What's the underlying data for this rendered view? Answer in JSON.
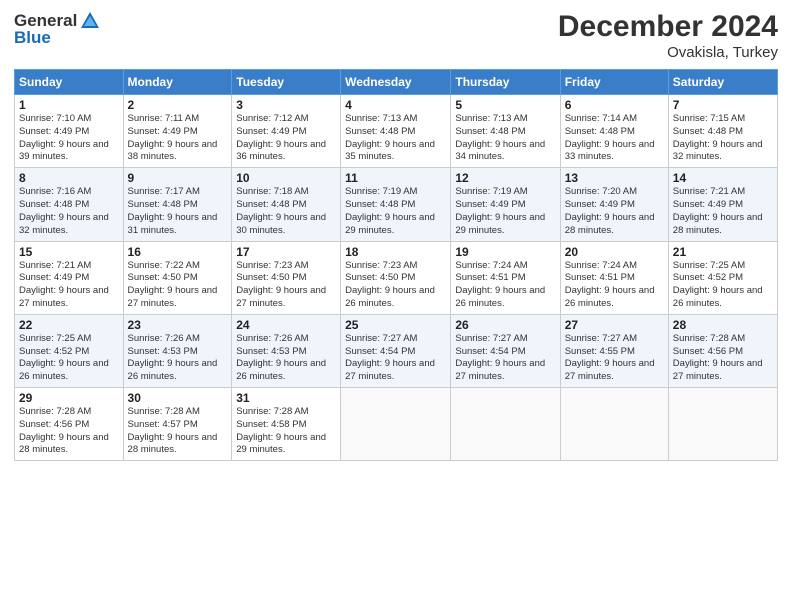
{
  "header": {
    "logo_general": "General",
    "logo_blue": "Blue",
    "month_title": "December 2024",
    "location": "Ovakisla, Turkey"
  },
  "columns": [
    "Sunday",
    "Monday",
    "Tuesday",
    "Wednesday",
    "Thursday",
    "Friday",
    "Saturday"
  ],
  "weeks": [
    [
      {
        "day": "1",
        "sunrise": "Sunrise: 7:10 AM",
        "sunset": "Sunset: 4:49 PM",
        "daylight": "Daylight: 9 hours and 39 minutes."
      },
      {
        "day": "2",
        "sunrise": "Sunrise: 7:11 AM",
        "sunset": "Sunset: 4:49 PM",
        "daylight": "Daylight: 9 hours and 38 minutes."
      },
      {
        "day": "3",
        "sunrise": "Sunrise: 7:12 AM",
        "sunset": "Sunset: 4:49 PM",
        "daylight": "Daylight: 9 hours and 36 minutes."
      },
      {
        "day": "4",
        "sunrise": "Sunrise: 7:13 AM",
        "sunset": "Sunset: 4:48 PM",
        "daylight": "Daylight: 9 hours and 35 minutes."
      },
      {
        "day": "5",
        "sunrise": "Sunrise: 7:13 AM",
        "sunset": "Sunset: 4:48 PM",
        "daylight": "Daylight: 9 hours and 34 minutes."
      },
      {
        "day": "6",
        "sunrise": "Sunrise: 7:14 AM",
        "sunset": "Sunset: 4:48 PM",
        "daylight": "Daylight: 9 hours and 33 minutes."
      },
      {
        "day": "7",
        "sunrise": "Sunrise: 7:15 AM",
        "sunset": "Sunset: 4:48 PM",
        "daylight": "Daylight: 9 hours and 32 minutes."
      }
    ],
    [
      {
        "day": "8",
        "sunrise": "Sunrise: 7:16 AM",
        "sunset": "Sunset: 4:48 PM",
        "daylight": "Daylight: 9 hours and 32 minutes."
      },
      {
        "day": "9",
        "sunrise": "Sunrise: 7:17 AM",
        "sunset": "Sunset: 4:48 PM",
        "daylight": "Daylight: 9 hours and 31 minutes."
      },
      {
        "day": "10",
        "sunrise": "Sunrise: 7:18 AM",
        "sunset": "Sunset: 4:48 PM",
        "daylight": "Daylight: 9 hours and 30 minutes."
      },
      {
        "day": "11",
        "sunrise": "Sunrise: 7:19 AM",
        "sunset": "Sunset: 4:48 PM",
        "daylight": "Daylight: 9 hours and 29 minutes."
      },
      {
        "day": "12",
        "sunrise": "Sunrise: 7:19 AM",
        "sunset": "Sunset: 4:49 PM",
        "daylight": "Daylight: 9 hours and 29 minutes."
      },
      {
        "day": "13",
        "sunrise": "Sunrise: 7:20 AM",
        "sunset": "Sunset: 4:49 PM",
        "daylight": "Daylight: 9 hours and 28 minutes."
      },
      {
        "day": "14",
        "sunrise": "Sunrise: 7:21 AM",
        "sunset": "Sunset: 4:49 PM",
        "daylight": "Daylight: 9 hours and 28 minutes."
      }
    ],
    [
      {
        "day": "15",
        "sunrise": "Sunrise: 7:21 AM",
        "sunset": "Sunset: 4:49 PM",
        "daylight": "Daylight: 9 hours and 27 minutes."
      },
      {
        "day": "16",
        "sunrise": "Sunrise: 7:22 AM",
        "sunset": "Sunset: 4:50 PM",
        "daylight": "Daylight: 9 hours and 27 minutes."
      },
      {
        "day": "17",
        "sunrise": "Sunrise: 7:23 AM",
        "sunset": "Sunset: 4:50 PM",
        "daylight": "Daylight: 9 hours and 27 minutes."
      },
      {
        "day": "18",
        "sunrise": "Sunrise: 7:23 AM",
        "sunset": "Sunset: 4:50 PM",
        "daylight": "Daylight: 9 hours and 26 minutes."
      },
      {
        "day": "19",
        "sunrise": "Sunrise: 7:24 AM",
        "sunset": "Sunset: 4:51 PM",
        "daylight": "Daylight: 9 hours and 26 minutes."
      },
      {
        "day": "20",
        "sunrise": "Sunrise: 7:24 AM",
        "sunset": "Sunset: 4:51 PM",
        "daylight": "Daylight: 9 hours and 26 minutes."
      },
      {
        "day": "21",
        "sunrise": "Sunrise: 7:25 AM",
        "sunset": "Sunset: 4:52 PM",
        "daylight": "Daylight: 9 hours and 26 minutes."
      }
    ],
    [
      {
        "day": "22",
        "sunrise": "Sunrise: 7:25 AM",
        "sunset": "Sunset: 4:52 PM",
        "daylight": "Daylight: 9 hours and 26 minutes."
      },
      {
        "day": "23",
        "sunrise": "Sunrise: 7:26 AM",
        "sunset": "Sunset: 4:53 PM",
        "daylight": "Daylight: 9 hours and 26 minutes."
      },
      {
        "day": "24",
        "sunrise": "Sunrise: 7:26 AM",
        "sunset": "Sunset: 4:53 PM",
        "daylight": "Daylight: 9 hours and 26 minutes."
      },
      {
        "day": "25",
        "sunrise": "Sunrise: 7:27 AM",
        "sunset": "Sunset: 4:54 PM",
        "daylight": "Daylight: 9 hours and 27 minutes."
      },
      {
        "day": "26",
        "sunrise": "Sunrise: 7:27 AM",
        "sunset": "Sunset: 4:54 PM",
        "daylight": "Daylight: 9 hours and 27 minutes."
      },
      {
        "day": "27",
        "sunrise": "Sunrise: 7:27 AM",
        "sunset": "Sunset: 4:55 PM",
        "daylight": "Daylight: 9 hours and 27 minutes."
      },
      {
        "day": "28",
        "sunrise": "Sunrise: 7:28 AM",
        "sunset": "Sunset: 4:56 PM",
        "daylight": "Daylight: 9 hours and 27 minutes."
      }
    ],
    [
      {
        "day": "29",
        "sunrise": "Sunrise: 7:28 AM",
        "sunset": "Sunset: 4:56 PM",
        "daylight": "Daylight: 9 hours and 28 minutes."
      },
      {
        "day": "30",
        "sunrise": "Sunrise: 7:28 AM",
        "sunset": "Sunset: 4:57 PM",
        "daylight": "Daylight: 9 hours and 28 minutes."
      },
      {
        "day": "31",
        "sunrise": "Sunrise: 7:28 AM",
        "sunset": "Sunset: 4:58 PM",
        "daylight": "Daylight: 9 hours and 29 minutes."
      },
      null,
      null,
      null,
      null
    ]
  ]
}
